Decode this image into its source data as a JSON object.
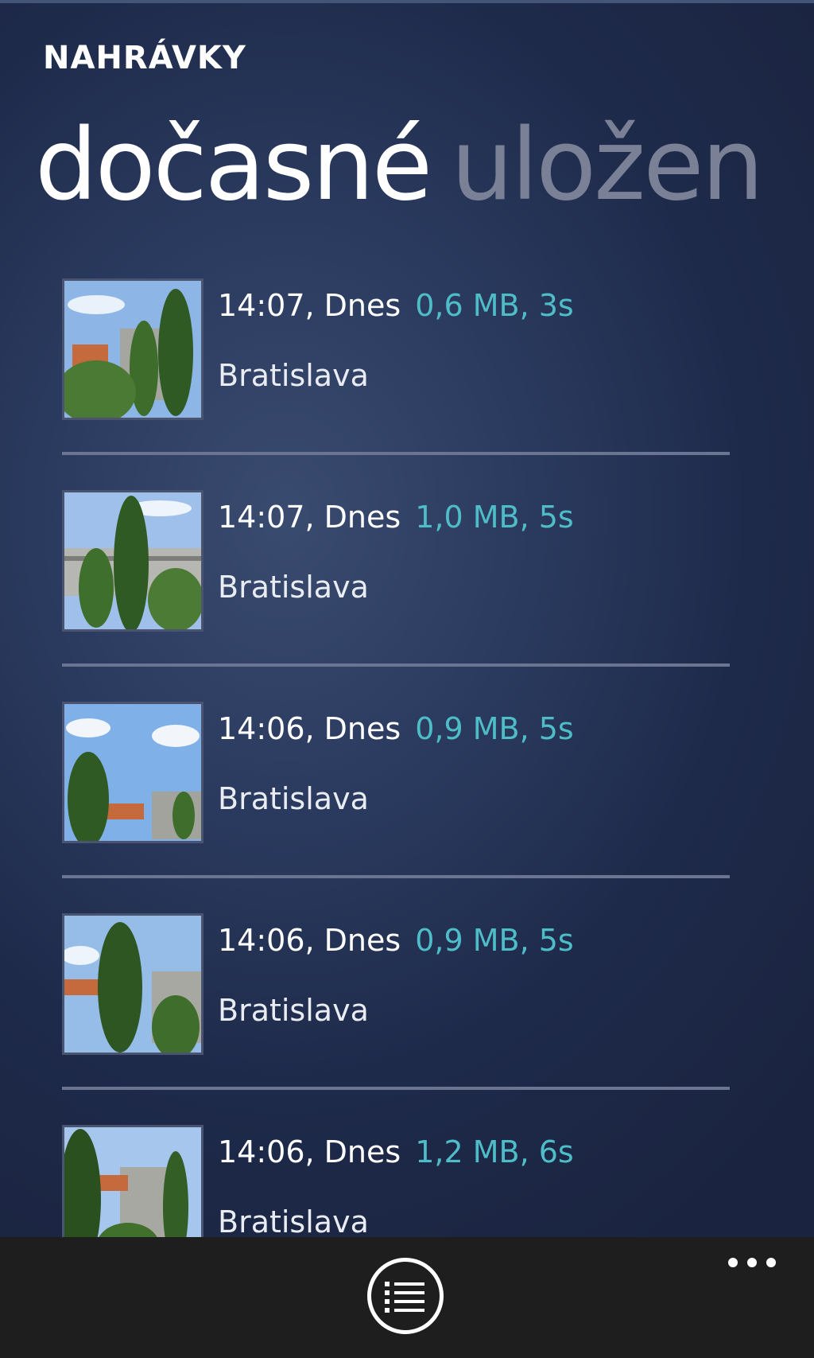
{
  "app": {
    "title": "NAHRÁVKY"
  },
  "pivot": {
    "active": "dočasné",
    "inactive": "uložen"
  },
  "recordings": [
    {
      "time": "14:07, Dnes",
      "meta": "0,6 MB, 3s",
      "place": "Bratislava"
    },
    {
      "time": "14:07, Dnes",
      "meta": "1,0 MB, 5s",
      "place": "Bratislava"
    },
    {
      "time": "14:06, Dnes",
      "meta": "0,9 MB, 5s",
      "place": "Bratislava"
    },
    {
      "time": "14:06, Dnes",
      "meta": "0,9 MB, 5s",
      "place": "Bratislava"
    },
    {
      "time": "14:06, Dnes",
      "meta": "1,2 MB, 6s",
      "place": "Bratislava"
    }
  ],
  "appbar": {
    "primary_icon": "list-icon",
    "more_icon": "more-icon"
  },
  "colors": {
    "accent": "#4fbdc8",
    "background": "#243250",
    "appbar": "#1e1e1e"
  }
}
